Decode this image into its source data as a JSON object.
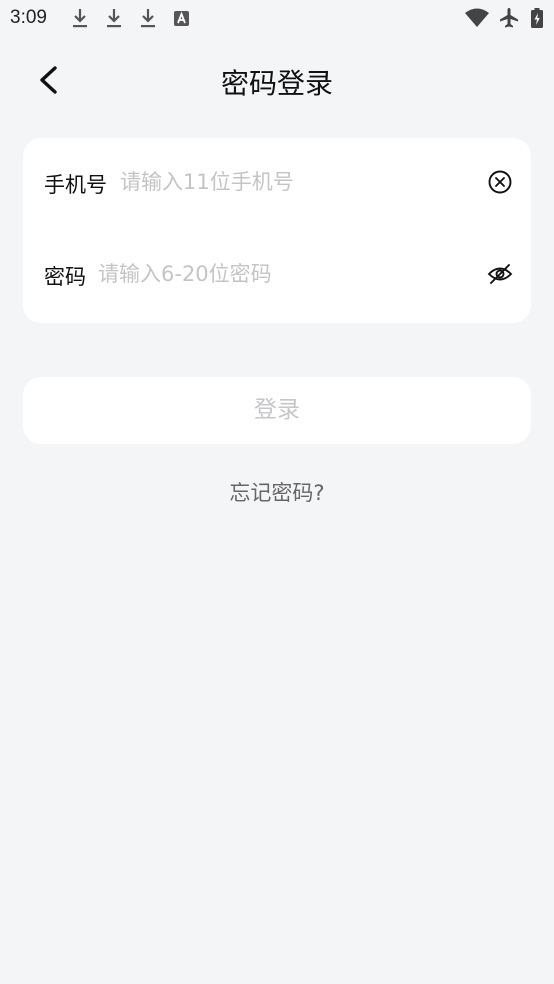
{
  "status_bar": {
    "time": "3:09",
    "left_icons": [
      "download-icon",
      "download-icon",
      "download-icon",
      "font-app-icon"
    ],
    "right_icons": [
      "wifi-icon",
      "airplane-mode-icon",
      "battery-charging-icon"
    ]
  },
  "header": {
    "title": "密码登录",
    "back_icon": "chevron-left-icon"
  },
  "form": {
    "phone": {
      "label": "手机号",
      "placeholder": "请输入11位手机号",
      "value": "",
      "action_icon": "clear-circle-icon"
    },
    "password": {
      "label": "密码",
      "placeholder": "请输入6-20位密码",
      "value": "",
      "action_icon": "eye-hidden-icon"
    }
  },
  "login_button": {
    "label": "登录",
    "enabled": false
  },
  "forgot_password": {
    "label": "忘记密码?"
  },
  "colors": {
    "background": "#f4f5f7",
    "card": "#ffffff",
    "placeholder": "#c4c4c6",
    "disabled_text": "#c6c6c8"
  }
}
